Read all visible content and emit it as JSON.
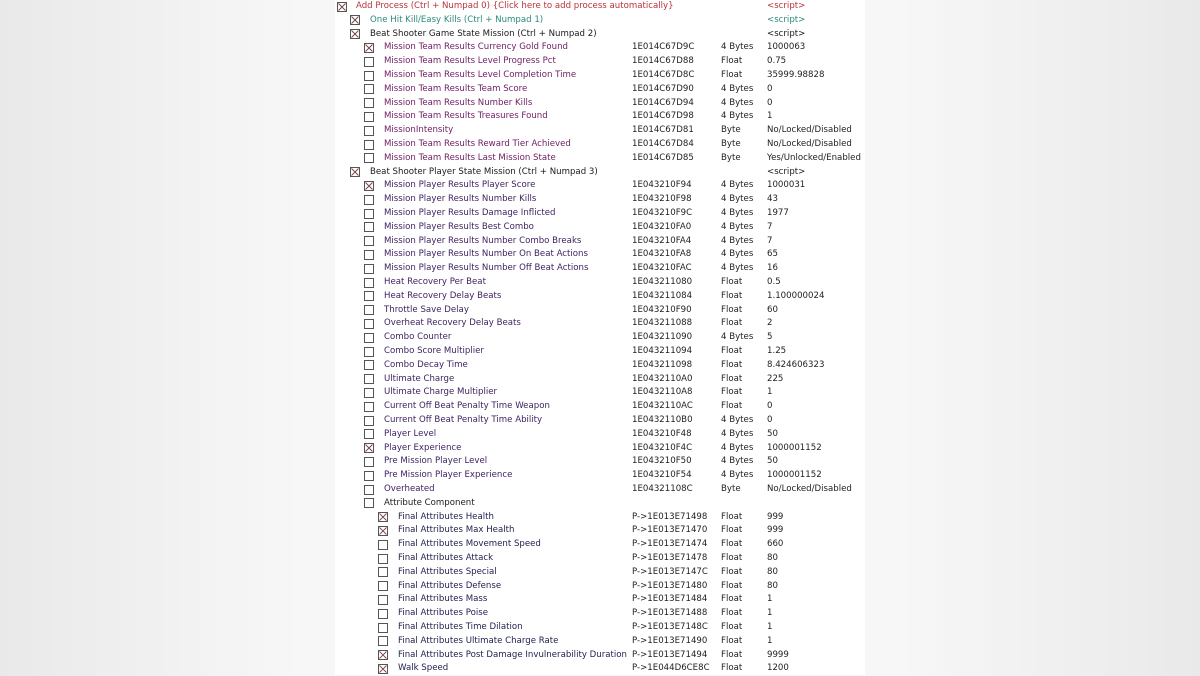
{
  "colors": {
    "red": "#b8323a",
    "teal": "#2b8a78",
    "black": "#1a1a1a",
    "purple": "#6e1c62",
    "darkpurple": "#3b1f5e",
    "navy": "#22224f"
  },
  "rows": [
    {
      "level": 0,
      "checked": true,
      "color": "red",
      "name": "Add Process (Ctrl + Numpad 0) {Click here to add process automatically}",
      "address": "",
      "type": "",
      "value": "<script>"
    },
    {
      "level": 1,
      "checked": true,
      "color": "teal",
      "name": "One Hit Kill/Easy Kills (Ctrl + Numpad 1)",
      "address": "",
      "type": "",
      "value": "<script>"
    },
    {
      "level": 1,
      "checked": true,
      "color": "black",
      "name": "Beat Shooter Game State Mission (Ctrl + Numpad 2)",
      "address": "",
      "type": "",
      "value": "<script>"
    },
    {
      "level": 2,
      "checked": true,
      "color": "purple",
      "name": "Mission Team Results Currency Gold Found",
      "address": "1E014C67D9C",
      "type": "4 Bytes",
      "value": "1000063"
    },
    {
      "level": 2,
      "checked": false,
      "color": "purple",
      "name": "Mission Team Results Level Progress Pct",
      "address": "1E014C67D88",
      "type": "Float",
      "value": "0.75"
    },
    {
      "level": 2,
      "checked": false,
      "color": "purple",
      "name": "Mission Team Results Level Completion Time",
      "address": "1E014C67D8C",
      "type": "Float",
      "value": "35999.98828"
    },
    {
      "level": 2,
      "checked": false,
      "color": "purple",
      "name": "Mission Team Results Team Score",
      "address": "1E014C67D90",
      "type": "4 Bytes",
      "value": "0"
    },
    {
      "level": 2,
      "checked": false,
      "color": "purple",
      "name": "Mission Team Results Number Kills",
      "address": "1E014C67D94",
      "type": "4 Bytes",
      "value": "0"
    },
    {
      "level": 2,
      "checked": false,
      "color": "purple",
      "name": "Mission Team Results Treasures Found",
      "address": "1E014C67D98",
      "type": "4 Bytes",
      "value": "1"
    },
    {
      "level": 2,
      "checked": false,
      "color": "purple",
      "name": "MissionIntensity",
      "address": "1E014C67D81",
      "type": "Byte",
      "value": "No/Locked/Disabled"
    },
    {
      "level": 2,
      "checked": false,
      "color": "purple",
      "name": "Mission Team Results Reward Tier Achieved",
      "address": "1E014C67D84",
      "type": "Byte",
      "value": "No/Locked/Disabled"
    },
    {
      "level": 2,
      "checked": false,
      "color": "purple",
      "name": "Mission Team Results Last Mission State",
      "address": "1E014C67D85",
      "type": "Byte",
      "value": "Yes/Unlocked/Enabled"
    },
    {
      "level": 1,
      "checked": true,
      "color": "black",
      "name": "Beat Shooter Player State Mission (Ctrl + Numpad 3)",
      "address": "",
      "type": "",
      "value": "<script>"
    },
    {
      "level": 2,
      "checked": true,
      "color": "darkpurple",
      "name": "Mission Player Results Player Score",
      "address": "1E043210F94",
      "type": "4 Bytes",
      "value": "1000031"
    },
    {
      "level": 2,
      "checked": false,
      "color": "darkpurple",
      "name": "Mission Player Results Number Kills",
      "address": "1E043210F98",
      "type": "4 Bytes",
      "value": "43"
    },
    {
      "level": 2,
      "checked": false,
      "color": "darkpurple",
      "name": "Mission Player Results Damage Inflicted",
      "address": "1E043210F9C",
      "type": "4 Bytes",
      "value": "1977"
    },
    {
      "level": 2,
      "checked": false,
      "color": "darkpurple",
      "name": "Mission Player Results Best Combo",
      "address": "1E043210FA0",
      "type": "4 Bytes",
      "value": "7"
    },
    {
      "level": 2,
      "checked": false,
      "color": "darkpurple",
      "name": "Mission Player Results Number Combo Breaks",
      "address": "1E043210FA4",
      "type": "4 Bytes",
      "value": "7"
    },
    {
      "level": 2,
      "checked": false,
      "color": "darkpurple",
      "name": "Mission Player Results Number On Beat Actions",
      "address": "1E043210FA8",
      "type": "4 Bytes",
      "value": "65"
    },
    {
      "level": 2,
      "checked": false,
      "color": "darkpurple",
      "name": "Mission Player Results Number Off Beat Actions",
      "address": "1E043210FAC",
      "type": "4 Bytes",
      "value": "16"
    },
    {
      "level": 2,
      "checked": false,
      "color": "darkpurple",
      "name": "Heat Recovery Per Beat",
      "address": "1E043211080",
      "type": "Float",
      "value": "0.5"
    },
    {
      "level": 2,
      "checked": false,
      "color": "darkpurple",
      "name": "Heat Recovery Delay Beats",
      "address": "1E043211084",
      "type": "Float",
      "value": "1.100000024"
    },
    {
      "level": 2,
      "checked": false,
      "color": "darkpurple",
      "name": "Throttle Save Delay",
      "address": "1E043210F90",
      "type": "Float",
      "value": "60"
    },
    {
      "level": 2,
      "checked": false,
      "color": "darkpurple",
      "name": "Overheat Recovery Delay Beats",
      "address": "1E043211088",
      "type": "Float",
      "value": "2"
    },
    {
      "level": 2,
      "checked": false,
      "color": "darkpurple",
      "name": "Combo Counter",
      "address": "1E043211090",
      "type": "4 Bytes",
      "value": "5"
    },
    {
      "level": 2,
      "checked": false,
      "color": "darkpurple",
      "name": "Combo Score Multiplier",
      "address": "1E043211094",
      "type": "Float",
      "value": "1.25"
    },
    {
      "level": 2,
      "checked": false,
      "color": "darkpurple",
      "name": "Combo Decay Time",
      "address": "1E043211098",
      "type": "Float",
      "value": "8.424606323"
    },
    {
      "level": 2,
      "checked": false,
      "color": "darkpurple",
      "name": "Ultimate Charge",
      "address": "1E0432110A0",
      "type": "Float",
      "value": "225"
    },
    {
      "level": 2,
      "checked": false,
      "color": "darkpurple",
      "name": "Ultimate Charge Multiplier",
      "address": "1E0432110A8",
      "type": "Float",
      "value": "1"
    },
    {
      "level": 2,
      "checked": false,
      "color": "darkpurple",
      "name": "Current Off Beat Penalty Time Weapon",
      "address": "1E0432110AC",
      "type": "Float",
      "value": "0"
    },
    {
      "level": 2,
      "checked": false,
      "color": "darkpurple",
      "name": "Current Off Beat Penalty Time Ability",
      "address": "1E0432110B0",
      "type": "4 Bytes",
      "value": "0"
    },
    {
      "level": 2,
      "checked": false,
      "color": "darkpurple",
      "name": "Player Level",
      "address": "1E043210F48",
      "type": "4 Bytes",
      "value": "50"
    },
    {
      "level": 2,
      "checked": true,
      "color": "darkpurple",
      "name": "Player Experience",
      "address": "1E043210F4C",
      "type": "4 Bytes",
      "value": "1000001152"
    },
    {
      "level": 2,
      "checked": false,
      "color": "darkpurple",
      "name": "Pre Mission Player Level",
      "address": "1E043210F50",
      "type": "4 Bytes",
      "value": "50"
    },
    {
      "level": 2,
      "checked": false,
      "color": "darkpurple",
      "name": "Pre Mission Player Experience",
      "address": "1E043210F54",
      "type": "4 Bytes",
      "value": "1000001152"
    },
    {
      "level": 2,
      "checked": false,
      "color": "darkpurple",
      "name": "Overheated",
      "address": "1E04321108C",
      "type": "Byte",
      "value": "No/Locked/Disabled"
    },
    {
      "level": 2,
      "checked": false,
      "color": "black",
      "name": "Attribute Component",
      "address": "",
      "type": "",
      "value": ""
    },
    {
      "level": 3,
      "checked": true,
      "color": "navy",
      "name": "Final Attributes Health",
      "address": "P->1E013E71498",
      "type": "Float",
      "value": "999"
    },
    {
      "level": 3,
      "checked": true,
      "color": "navy",
      "name": "Final Attributes Max Health",
      "address": "P->1E013E71470",
      "type": "Float",
      "value": "999"
    },
    {
      "level": 3,
      "checked": false,
      "color": "navy",
      "name": "Final Attributes Movement Speed",
      "address": "P->1E013E71474",
      "type": "Float",
      "value": "660"
    },
    {
      "level": 3,
      "checked": false,
      "color": "navy",
      "name": "Final Attributes Attack",
      "address": "P->1E013E71478",
      "type": "Float",
      "value": "80"
    },
    {
      "level": 3,
      "checked": false,
      "color": "navy",
      "name": "Final Attributes Special",
      "address": "P->1E013E7147C",
      "type": "Float",
      "value": "80"
    },
    {
      "level": 3,
      "checked": false,
      "color": "navy",
      "name": "Final Attributes Defense",
      "address": "P->1E013E71480",
      "type": "Float",
      "value": "80"
    },
    {
      "level": 3,
      "checked": false,
      "color": "navy",
      "name": "Final Attributes Mass",
      "address": "P->1E013E71484",
      "type": "Float",
      "value": "1"
    },
    {
      "level": 3,
      "checked": false,
      "color": "navy",
      "name": "Final Attributes Poise",
      "address": "P->1E013E71488",
      "type": "Float",
      "value": "1"
    },
    {
      "level": 3,
      "checked": false,
      "color": "navy",
      "name": "Final Attributes Time Dilation",
      "address": "P->1E013E7148C",
      "type": "Float",
      "value": "1"
    },
    {
      "level": 3,
      "checked": false,
      "color": "navy",
      "name": "Final Attributes Ultimate Charge Rate",
      "address": "P->1E013E71490",
      "type": "Float",
      "value": "1"
    },
    {
      "level": 3,
      "checked": true,
      "color": "navy",
      "name": "Final Attributes Post Damage Invulnerability Duration",
      "address": "P->1E013E71494",
      "type": "Float",
      "value": "9999"
    },
    {
      "level": 3,
      "checked": true,
      "color": "navy",
      "name": "Walk Speed",
      "address": "P->1E044D6CE8C",
      "type": "Float",
      "value": "1200"
    }
  ]
}
